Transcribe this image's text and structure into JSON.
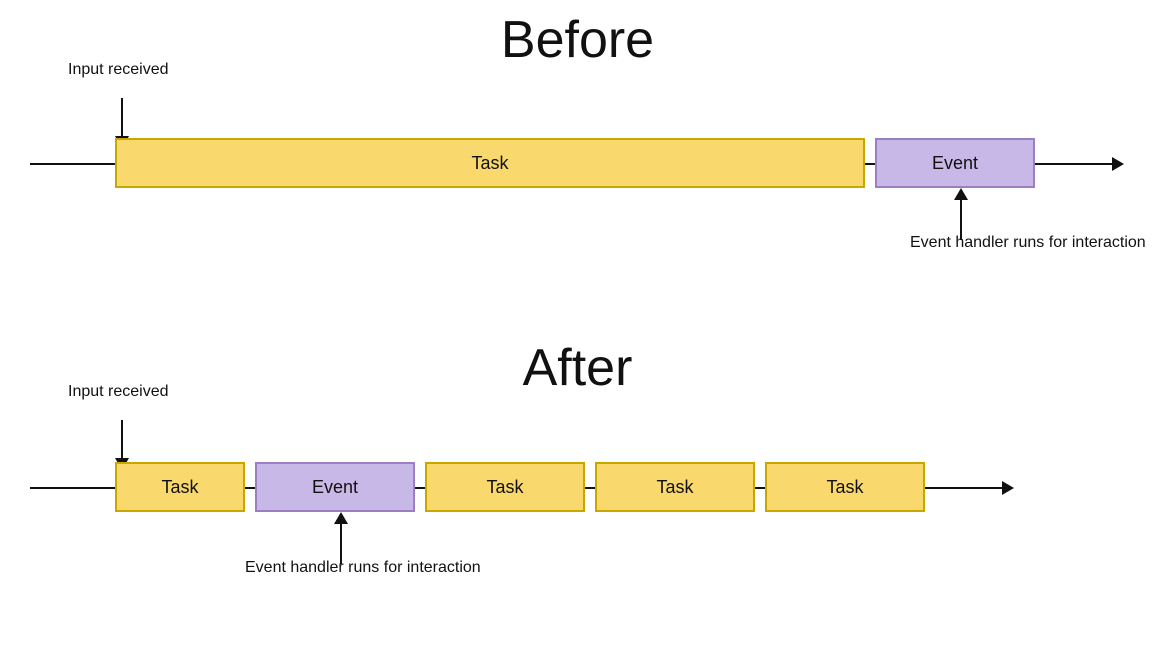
{
  "before": {
    "title": "Before",
    "input_received_label": "Input\nreceived",
    "task_label": "Task",
    "event_label": "Event",
    "event_handler_label": "Event handler\nruns for interaction"
  },
  "after": {
    "title": "After",
    "input_received_label": "Input\nreceived",
    "task_label": "Task",
    "event_label": "Event",
    "task2_label": "Task",
    "task3_label": "Task",
    "task4_label": "Task",
    "event_handler_label": "Event handler\nruns for interaction"
  }
}
